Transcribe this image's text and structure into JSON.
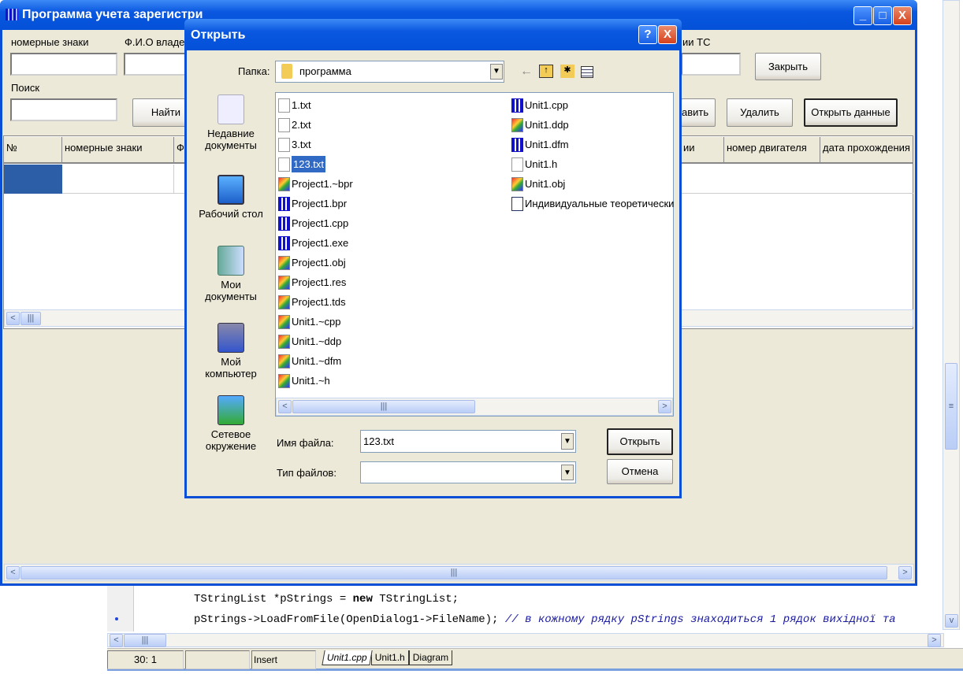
{
  "main_window": {
    "title": "Программа учета зарегистри",
    "buttons": {
      "minimize": "_",
      "maximize": "□",
      "close": "X"
    }
  },
  "form": {
    "plates_label": "номерные знаки",
    "owner_label": "Ф.И.О владе",
    "vehicle_label": "ии ТС",
    "search_label": "Поиск",
    "find_button": "Найти",
    "close_button": "Закрыть",
    "add_button": "авить",
    "delete_button": "Удалить",
    "open_data_button": "Открыть данные"
  },
  "grid": {
    "columns": [
      "№",
      "номерные знаки",
      "Ф",
      "ии",
      "номер двигателя",
      "дата прохождения Т"
    ]
  },
  "dialog": {
    "title": "Открыть",
    "help": "?",
    "close": "X",
    "folder_label": "Папка:",
    "folder_value": "программа",
    "places": [
      {
        "label": "Недавние документы",
        "icon": "recent-documents-icon"
      },
      {
        "label": "Рабочий стол",
        "icon": "desktop-icon"
      },
      {
        "label": "Мои документы",
        "icon": "my-documents-icon"
      },
      {
        "label": "Мой компьютер",
        "icon": "my-computer-icon"
      },
      {
        "label": "Сетевое окружение",
        "icon": "network-icon"
      }
    ],
    "files_col1": [
      {
        "name": "1.txt",
        "type": "txt"
      },
      {
        "name": "2.txt",
        "type": "txt"
      },
      {
        "name": "3.txt",
        "type": "txt"
      },
      {
        "name": "123.txt",
        "type": "txt",
        "selected": true
      },
      {
        "name": "Project1.~bpr",
        "type": "exe"
      },
      {
        "name": "Project1.bpr",
        "type": "bpr"
      },
      {
        "name": "Project1.cpp",
        "type": "bpr"
      },
      {
        "name": "Project1.exe",
        "type": "bpr"
      },
      {
        "name": "Project1.obj",
        "type": "exe"
      },
      {
        "name": "Project1.res",
        "type": "exe"
      },
      {
        "name": "Project1.tds",
        "type": "exe"
      },
      {
        "name": "Unit1.~cpp",
        "type": "exe"
      },
      {
        "name": "Unit1.~ddp",
        "type": "exe"
      },
      {
        "name": "Unit1.~dfm",
        "type": "exe"
      },
      {
        "name": "Unit1.~h",
        "type": "exe"
      }
    ],
    "files_col2": [
      {
        "name": "Unit1.cpp",
        "type": "bpr"
      },
      {
        "name": "Unit1.ddp",
        "type": "exe"
      },
      {
        "name": "Unit1.dfm",
        "type": "bpr"
      },
      {
        "name": "Unit1.h",
        "type": "txt"
      },
      {
        "name": "Unit1.obj",
        "type": "exe"
      },
      {
        "name": "Индивидуальные теоретически",
        "type": "doc"
      }
    ],
    "filename_label": "Имя файла:",
    "filename_value": "123.txt",
    "filetype_label": "Тип файлов:",
    "filetype_value": "",
    "open_button": "Открыть",
    "cancel_button": "Отмена"
  },
  "editor": {
    "line1_a": "TStringList *pStrings = ",
    "line1_kw": "new",
    "line1_b": " TStringList;",
    "line2_code": "pStrings->LoadFromFile(OpenDialog1->FileName); ",
    "line2_comment": "// в кожному рядку pStrings знаходиться 1 рядок вихідної та",
    "status": {
      "position": "30:  1",
      "mode": "Insert"
    },
    "tabs": [
      "Unit1.cpp",
      "Unit1.h",
      "Diagram"
    ]
  }
}
